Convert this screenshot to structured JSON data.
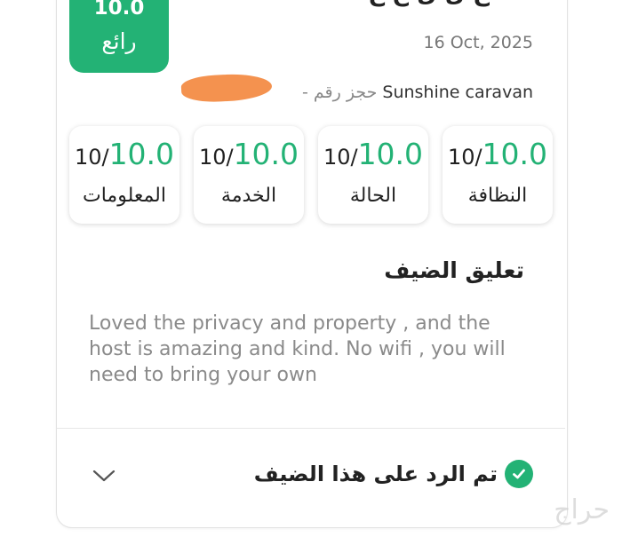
{
  "header": {
    "score": "10.0",
    "score_word": "رائع",
    "title_partial": "ع ل ل ح ع",
    "date": "16 Oct, 2025",
    "unit_name": "Sunshine caravan",
    "booking_prefix": "- حجز رقم"
  },
  "ratings": [
    {
      "score": "10.0",
      "out_of": "10/",
      "label": "النظافة"
    },
    {
      "score": "10.0",
      "out_of": "10/",
      "label": "الحالة"
    },
    {
      "score": "10.0",
      "out_of": "10/",
      "label": "الخدمة"
    },
    {
      "score": "10.0",
      "out_of": "10/",
      "label": "المعلومات"
    }
  ],
  "comment": {
    "title": "تعليق الضيف",
    "text": "Loved the privacy and property , and the host is amazing and kind. No wifi , you will need to bring your own"
  },
  "reply": {
    "status": "تم الرد على هذا الضيف"
  },
  "watermark": "حراج",
  "colors": {
    "accent": "#23b275",
    "redaction": "#f4924f",
    "muted_text": "#8a8a8a"
  },
  "icons": {
    "reply_status": "check-circle-icon",
    "expand": "chevron-down-icon"
  }
}
